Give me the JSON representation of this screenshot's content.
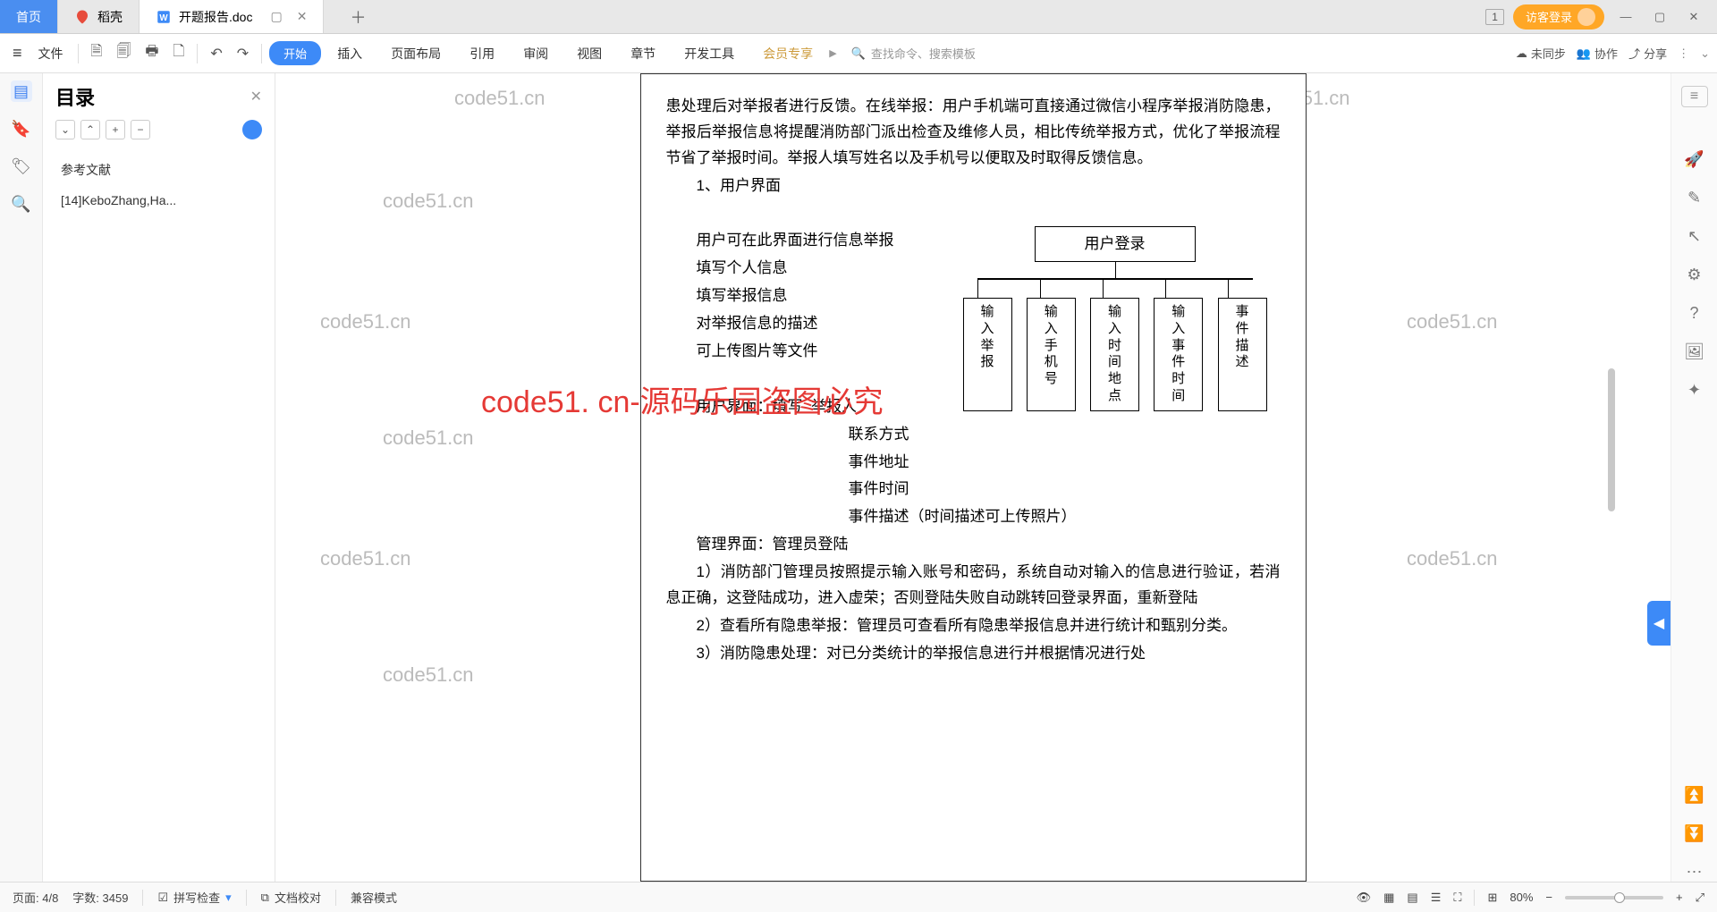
{
  "tabs": {
    "home": "首页",
    "daoke": "稻壳",
    "doc": "开题报告.doc"
  },
  "titlebar": {
    "badge": "1",
    "login": "访客登录"
  },
  "ribbon": {
    "file": "文件",
    "start": "开始",
    "insert": "插入",
    "page_layout": "页面布局",
    "reference": "引用",
    "review": "审阅",
    "view": "视图",
    "chapter": "章节",
    "dev": "开发工具",
    "vip": "会员专享",
    "search_placeholder": "查找命令、搜索模板",
    "unsync": "未同步",
    "collab": "协作",
    "share": "分享"
  },
  "outline": {
    "title": "目录",
    "items": [
      "参考文献",
      "[14]KeboZhang,Ha..."
    ]
  },
  "doc": {
    "para_top": "患处理后对举报者进行反馈。在线举报：用户手机端可直接通过微信小程序举报消防隐患，举报后举报信息将提醒消防部门派出检查及维修人员，相比传统举报方式，优化了举报流程节省了举报时间。举报人填写姓名以及手机号以便取及时取得反馈信息。",
    "s1": "1、用户界面",
    "s2": "用户可在此界面进行信息举报",
    "s3": "填写个人信息",
    "s4": "填写举报信息",
    "s5": "对举报信息的描述",
    "s6": "可上传图片等文件",
    "ui_label": "用户界面：填写",
    "ui_a": "举报人",
    "ui_b": "联系方式",
    "ui_c": "事件地址",
    "ui_d": "事件时间",
    "ui_e": "事件描述（时间描述可上传照片）",
    "admin_label": "管理界面：管理员登陆",
    "p1": "1）消防部门管理员按照提示输入账号和密码，系统自动对输入的信息进行验证，若消息正确，这登陆成功，进入虚荣；否则登陆失败自动跳转回登录界面，重新登陆",
    "p2": "2）查看所有隐患举报：管理员可查看所有隐患举报信息并进行统计和甄别分类。",
    "p3": "3）消防隐患处理：对已分类统计的举报信息进行并根据情况进行处",
    "dg_top": "用户登录",
    "dg_boxes": [
      "输入举报",
      "输入手机号",
      "输入时间地点",
      "输入事件时间",
      "事件描述"
    ]
  },
  "watermark": {
    "grey": "code51.cn",
    "red": "code51. cn-源码乐园盗图必究"
  },
  "status": {
    "page": "页面: 4/8",
    "words": "字数: 3459",
    "spellcheck": "拼写检查",
    "proofread": "文档校对",
    "compat": "兼容模式",
    "zoom": "80%"
  }
}
